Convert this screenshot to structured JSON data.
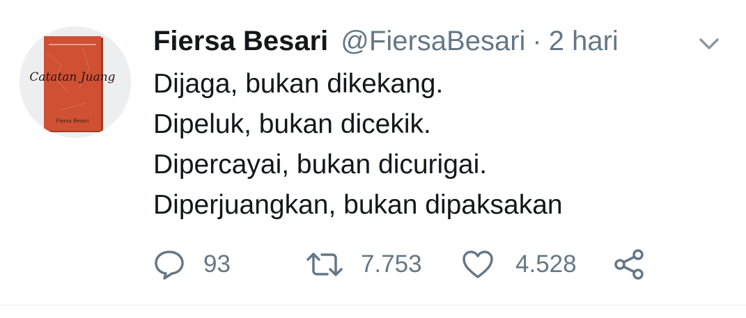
{
  "tweet": {
    "author_name": "Fiersa Besari",
    "handle": "@FiersaBesari",
    "separator": "·",
    "time": "2 hari",
    "lines": [
      "Dijaga, bukan dikekang.",
      "Dipeluk, bukan dicekik.",
      "Dipercayai, bukan dicurigai.",
      "Diperjuangkan, bukan dipaksakan"
    ],
    "avatar": {
      "icon": "book-cover-avatar",
      "book_title": "Catatan Juang",
      "book_author": "Fiersa Besari"
    }
  },
  "actions": {
    "replies": "93",
    "retweets": "7.753",
    "likes": "4.528",
    "reply_icon": "comment-icon",
    "retweet_icon": "retweet-icon",
    "like_icon": "heart-icon",
    "share_icon": "share-icon"
  },
  "colors": {
    "text": "#14171a",
    "secondary": "#657786",
    "divider": "#e6ecf0",
    "book_red": "#c94a2c"
  }
}
